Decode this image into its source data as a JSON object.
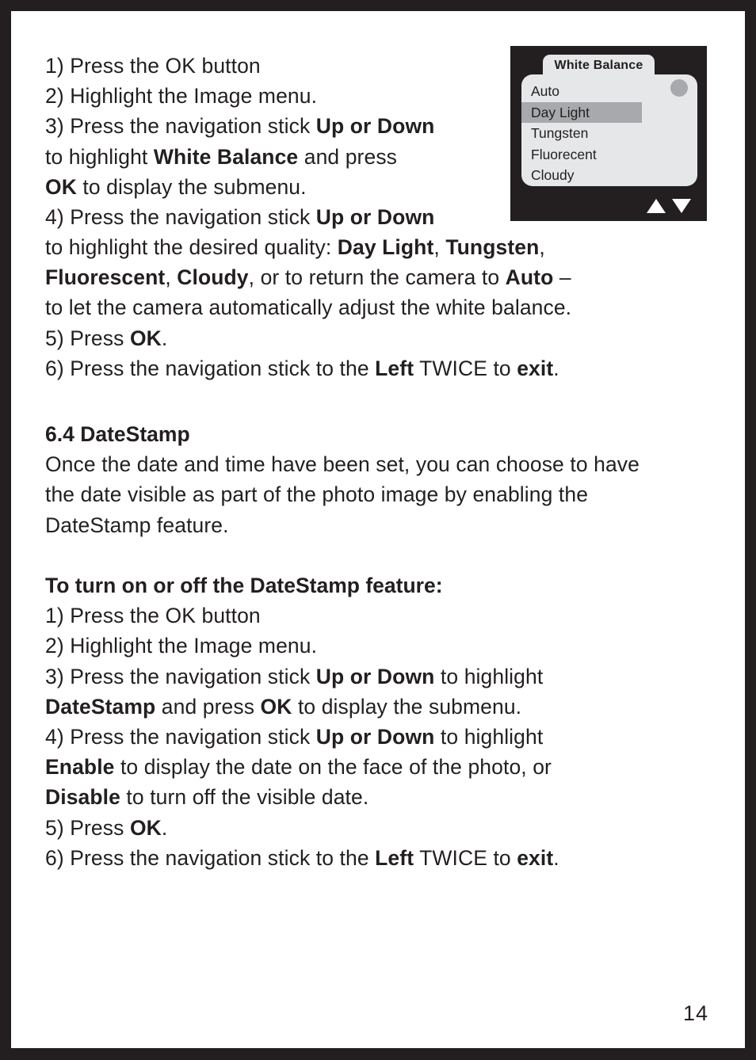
{
  "page": {
    "number": "14",
    "border_color": "#231F20",
    "background_color": "#FFFFFF"
  },
  "white_balance_instructions": {
    "line_1": "1) Press the OK button",
    "line_2": "2) Highlight the Image menu.",
    "line_3a": "3) Press the navigation stick ",
    "line_3b": "Up or Down",
    "line_4a": "to highlight ",
    "line_4b": "White Balance",
    "line_4c": " and press",
    "line_5a": "OK",
    "line_5b": " to display the submenu.",
    "line_6a": "4) Press the navigation stick ",
    "line_6b": "Up or Down",
    "line_7a": "to highlight the desired quality: ",
    "line_7b": "Day Light",
    "line_7c": ", ",
    "line_7d": "Tungsten",
    "line_7e": ",",
    "line_8a": "Fluorescent",
    "line_8b": ", ",
    "line_8c": "Cloudy",
    "line_8d": ", or to return the camera to ",
    "line_8e": "Auto",
    "line_8f": " –",
    "line_9": "to let the camera automatically adjust the white balance.",
    "line_10a": "5) Press ",
    "line_10b": "OK",
    "line_10c": ".",
    "line_11a": "6) Press the navigation stick to the ",
    "line_11b": "Left",
    "line_11c": " TWICE to ",
    "line_11d": "exit",
    "line_11e": "."
  },
  "section": {
    "heading": "6.4 DateStamp",
    "body_line_1": "Once the date and time have been set, you can choose to have",
    "body_line_2": "the date visible as part of the photo image by enabling the",
    "body_line_3": "DateStamp feature."
  },
  "datestamp_instructions": {
    "heading": "To turn on or off the DateStamp feature:",
    "line_1": "1) Press the OK button",
    "line_2": "2) Highlight the Image menu.",
    "line_3a": "3) Press the navigation stick ",
    "line_3b": "Up or Down",
    "line_3c": " to highlight",
    "line_4a": "DateStamp",
    "line_4b": " and press ",
    "line_4c": "OK",
    "line_4d": " to display the submenu.",
    "line_5a": "4) Press the navigation stick ",
    "line_5b": "Up or Down",
    "line_5c": " to highlight",
    "line_6a": "Enable",
    "line_6b": " to display the date on the face of the photo, or",
    "line_7a": "Disable",
    "line_7b": " to turn off the visible date.",
    "line_8a": "5) Press ",
    "line_8b": "OK",
    "line_8c": ".",
    "line_9a": "6) Press the navigation stick to the ",
    "line_9b": "Left",
    "line_9c": " TWICE to ",
    "line_9d": "exit",
    "line_9e": "."
  },
  "camera_screen": {
    "title": "White Balance",
    "screen_background": "#231F20",
    "panel_background": "#E6E7E8",
    "highlight_color": "#A7A9AC",
    "options": [
      {
        "label": "Auto",
        "selected": false
      },
      {
        "label": "Day Light",
        "selected": true
      },
      {
        "label": "Tungsten",
        "selected": false
      },
      {
        "label": "Fluorecent",
        "selected": false
      },
      {
        "label": "Cloudy",
        "selected": false
      }
    ],
    "scroll_indicator": "dot",
    "nav_hint_up": "▲",
    "nav_hint_down": "▼"
  }
}
